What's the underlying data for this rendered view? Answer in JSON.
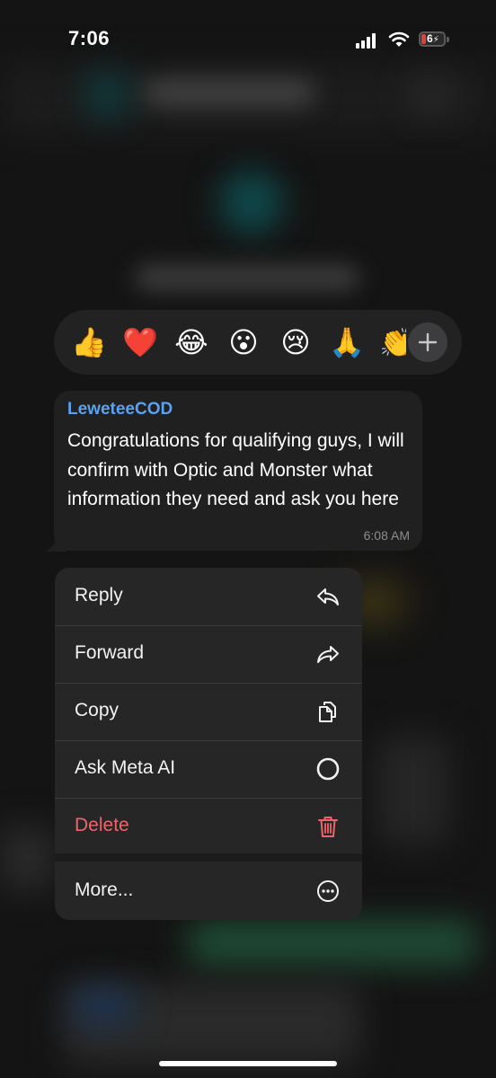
{
  "status_bar": {
    "time": "7:06",
    "battery_level": "6",
    "battery_color": "#e0413d"
  },
  "reactions": {
    "items": [
      "👍",
      "❤️",
      "😂",
      "😮",
      "😢",
      "🙏",
      "👏"
    ],
    "add_icon": "plus-icon"
  },
  "message": {
    "sender": "LeweteeCOD",
    "sender_color": "#5aa1f0",
    "text": "Congratulations for qualifying guys, I will confirm with Optic and Monster what information they need and ask you here",
    "time": "6:08 AM"
  },
  "menu": {
    "items": [
      {
        "label": "Reply",
        "icon": "reply-icon"
      },
      {
        "label": "Forward",
        "icon": "forward-icon"
      },
      {
        "label": "Copy",
        "icon": "copy-icon"
      },
      {
        "label": "Ask Meta AI",
        "icon": "meta-ai-icon"
      },
      {
        "label": "Delete",
        "icon": "trash-icon",
        "color": "#f0646c"
      },
      {
        "label": "More...",
        "icon": "more-icon"
      }
    ]
  }
}
